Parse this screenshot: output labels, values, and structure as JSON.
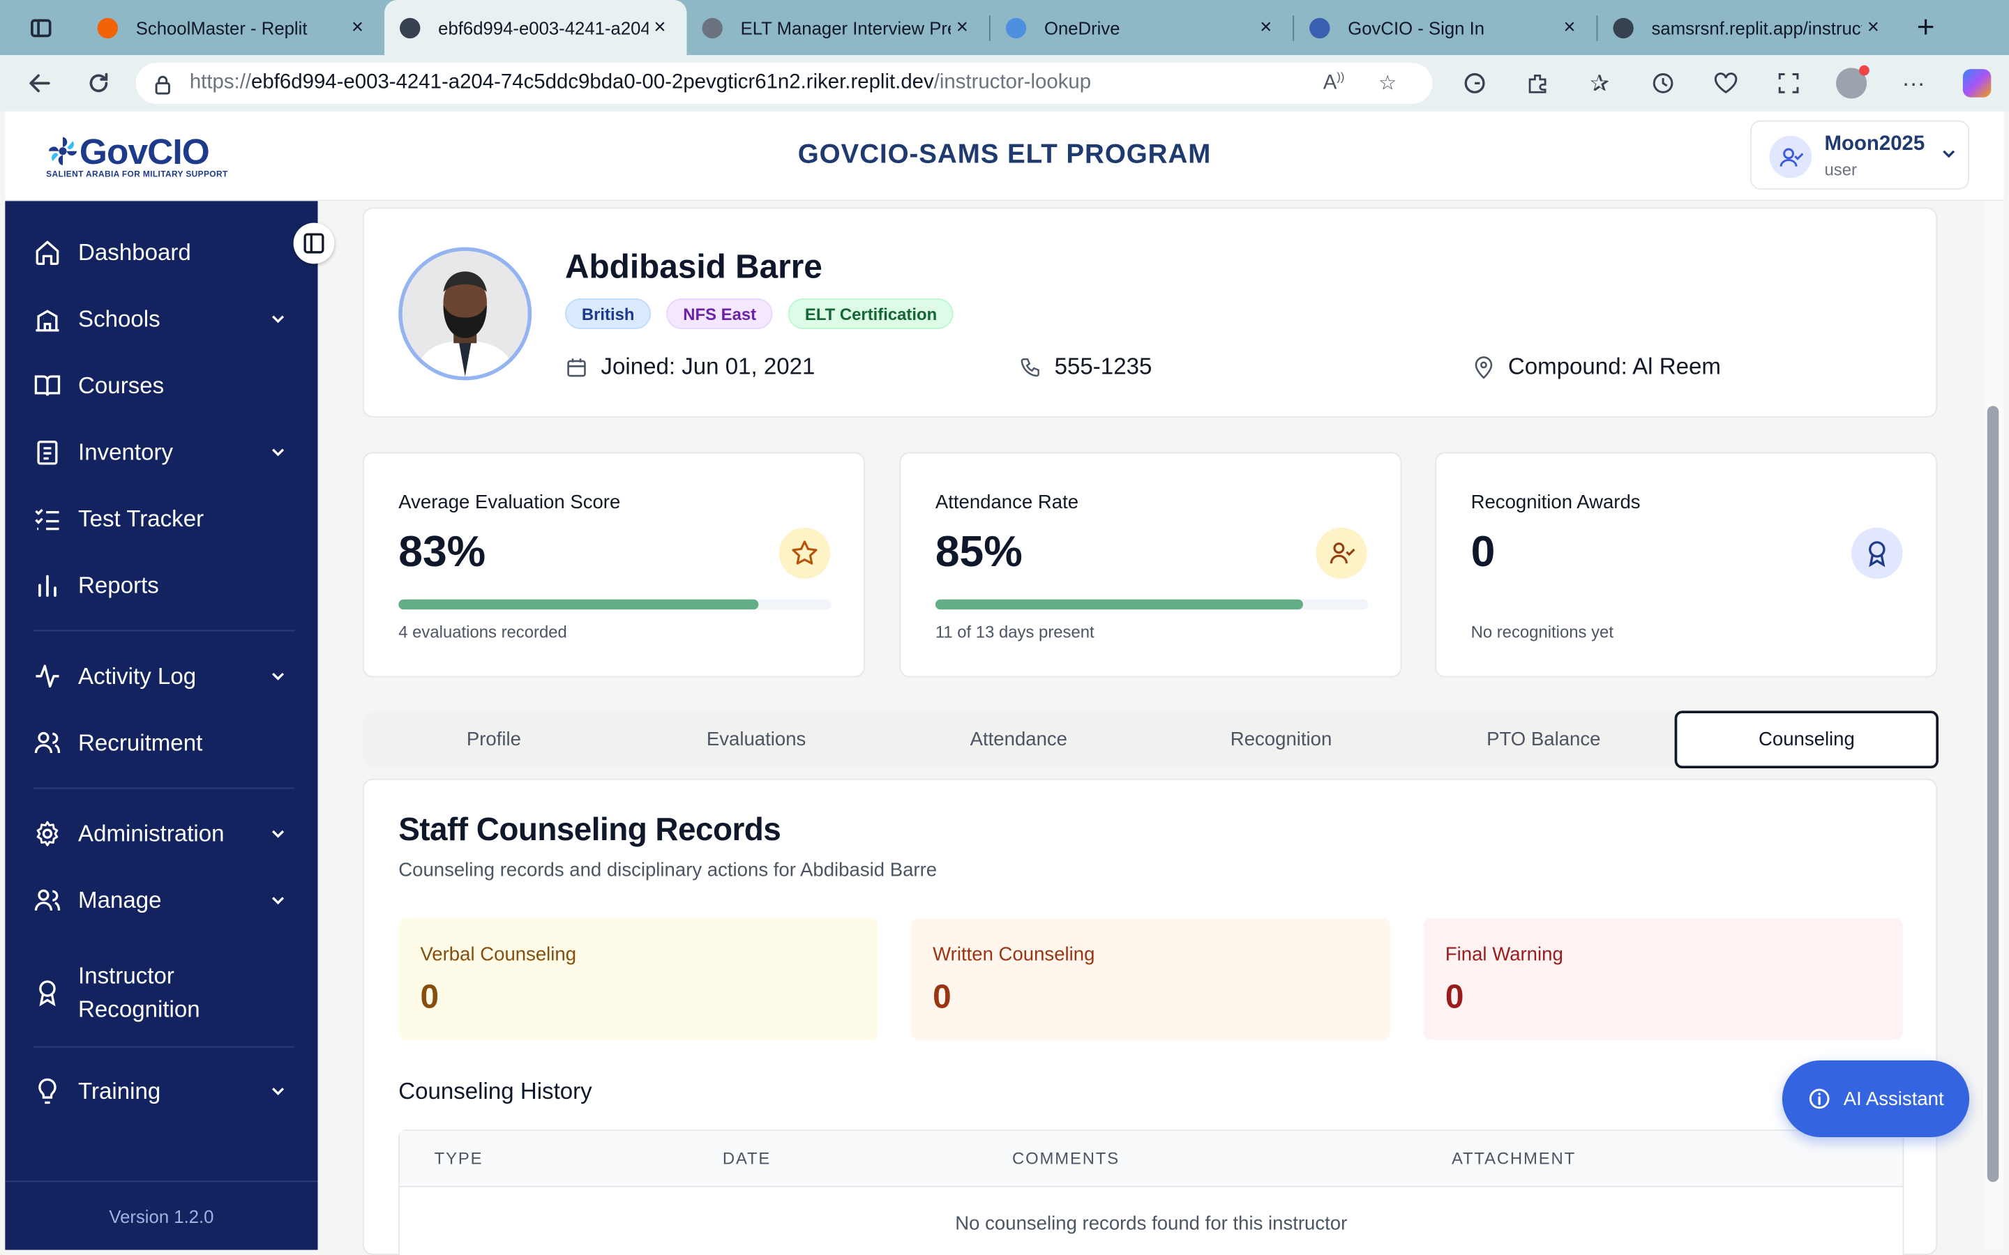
{
  "browser": {
    "tabs": [
      {
        "title": "SchoolMaster - Replit",
        "active": false,
        "favicon_color": "#f26207"
      },
      {
        "title": "ebf6d994-e003-4241-a204",
        "active": true,
        "favicon_color": "#374151"
      },
      {
        "title": "ELT Manager Interview Prep",
        "active": false,
        "favicon_color": "#6b7280"
      },
      {
        "title": "OneDrive",
        "active": false,
        "favicon_color": "#4f8fe0"
      },
      {
        "title": "GovCIO - Sign In",
        "active": false,
        "favicon_color": "#3b5fb0"
      },
      {
        "title": "samsrsnf.replit.app/instruct",
        "active": false,
        "favicon_color": "#374151"
      }
    ],
    "url_prefix": "https://",
    "url_host": "ebf6d994-e003-4241-a204-74c5ddc9bda0-00-2pevgticr61n2.riker.replit.dev",
    "url_path": "/instructor-lookup"
  },
  "header": {
    "logo_text": "GovCIO",
    "logo_tagline": "SALIENT ARABIA FOR MILITARY SUPPORT",
    "title": "GOVCIO-SAMS ELT PROGRAM",
    "user_name": "Moon2025",
    "user_role": "user"
  },
  "sidebar": {
    "items": [
      {
        "label": "Dashboard",
        "icon": "home-icon",
        "has_children": false
      },
      {
        "label": "Schools",
        "icon": "school-icon",
        "has_children": true
      },
      {
        "label": "Courses",
        "icon": "book-icon",
        "has_children": false
      },
      {
        "label": "Inventory",
        "icon": "clipboard-icon",
        "has_children": true
      },
      {
        "label": "Test Tracker",
        "icon": "checklist-icon",
        "has_children": false
      },
      {
        "label": "Reports",
        "icon": "bar-chart-icon",
        "has_children": false
      },
      {
        "label": "Activity Log",
        "icon": "activity-icon",
        "has_children": true
      },
      {
        "label": "Recruitment",
        "icon": "users-icon",
        "has_children": false
      },
      {
        "label": "Administration",
        "icon": "gear-icon",
        "has_children": true
      },
      {
        "label": "Manage",
        "icon": "users-icon",
        "has_children": true
      },
      {
        "label": "Instructor Recognition",
        "icon": "award-icon",
        "has_children": false
      },
      {
        "label": "Training",
        "icon": "lightbulb-icon",
        "has_children": true
      }
    ],
    "version": "Version 1.2.0"
  },
  "profile": {
    "name": "Abdibasid Barre",
    "badges": [
      "British",
      "NFS East",
      "ELT Certification"
    ],
    "joined": "Joined: Jun 01, 2021",
    "phone": "555-1235",
    "compound": "Compound: Al Reem"
  },
  "stats": [
    {
      "title": "Average Evaluation Score",
      "value": "83%",
      "progress": 0.83,
      "footer": "4 evaluations recorded",
      "icon": "star-icon",
      "icon_bg": "#fef3c7",
      "icon_color": "#b45309"
    },
    {
      "title": "Attendance Rate",
      "value": "85%",
      "progress": 0.85,
      "footer": "11 of 13 days present",
      "icon": "user-check-icon",
      "icon_bg": "#fef3c7",
      "icon_color": "#92400e"
    },
    {
      "title": "Recognition Awards",
      "value": "0",
      "progress": null,
      "footer": "No recognitions yet",
      "icon": "award-icon",
      "icon_bg": "#e0e7ff",
      "icon_color": "#1e3a8a"
    }
  ],
  "tabs": {
    "items": [
      "Profile",
      "Evaluations",
      "Attendance",
      "Recognition",
      "PTO Balance",
      "Counseling"
    ],
    "active": "Counseling"
  },
  "counseling": {
    "title": "Staff Counseling Records",
    "subtitle": "Counseling records and disciplinary actions for Abdibasid Barre",
    "boxes": [
      {
        "label": "Verbal Counseling",
        "count": "0",
        "bg": "#fefce8",
        "color": "#854d0e"
      },
      {
        "label": "Written Counseling",
        "count": "0",
        "bg": "#fff7ed",
        "color": "#9a3412"
      },
      {
        "label": "Final Warning",
        "count": "0",
        "bg": "#fef2f2",
        "color": "#991b1b"
      }
    ],
    "history_title": "Counseling History",
    "columns": [
      "TYPE",
      "DATE",
      "COMMENTS",
      "ATTACHMENT"
    ],
    "empty_message": "No counseling records found for this instructor"
  },
  "ai_button": "AI Assistant"
}
